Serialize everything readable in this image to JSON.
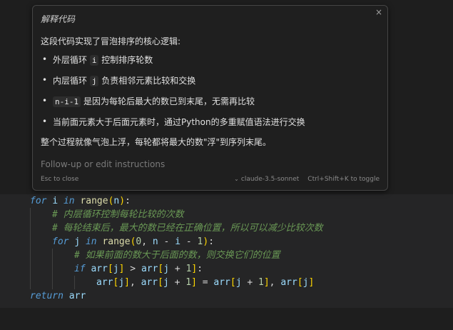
{
  "widget": {
    "title": "解释代码",
    "intro": "这段代码实现了冒泡排序的核心逻辑:",
    "bullet": "•",
    "items": [
      {
        "pre": "外层循环 ",
        "code": "i",
        "post": " 控制排序轮数"
      },
      {
        "pre": "内层循环 ",
        "code": "j",
        "post": " 负责相邻元素比较和交换"
      },
      {
        "pre": "",
        "code": "n-i-1",
        "post": " 是因为每轮后最大的数已到末尾，无需再比较"
      },
      {
        "pre": "当前面元素大于后面元素时，通过Python的多重赋值语法进行交换",
        "code": "",
        "post": ""
      }
    ],
    "summary": "整个过程就像气泡上浮，每轮都将最大的数\"浮\"到序列末尾。",
    "input_placeholder": "Follow-up or edit instructions",
    "input_value": "",
    "esc_hint": "Esc to close",
    "model": "claude-3.5-sonnet",
    "toggle_hint": "Ctrl+Shift+K to toggle",
    "close_glyph": "×",
    "chevron_glyph": "⌄"
  },
  "code": {
    "l1": {
      "for": "for",
      "i": "i",
      "in": "in",
      "range": "range",
      "p1": "(",
      "n": "n",
      "p2": ")",
      "colon": ":"
    },
    "l2": "# 内层循环控制每轮比较的次数",
    "l3": "# 每轮结束后，最大的数已经在正确位置，所以可以减少比较次数",
    "l4": {
      "for": "for",
      "j": "j",
      "in": "in",
      "range": "range",
      "p1": "(",
      "zero": "0",
      "comma": ", ",
      "n": "n",
      "minus1": " - ",
      "i": "i",
      "minus2": " - ",
      "one": "1",
      "p2": ")",
      "colon": ":"
    },
    "l5": "# 如果前面的数大于后面的数，则交换它们的位置",
    "l6": {
      "if": "if",
      "arr1": "arr",
      "b1": "[",
      "j1": "j",
      "b2": "]",
      "gt": " > ",
      "arr2": "arr",
      "b3": "[",
      "j2": "j",
      "plus": " + ",
      "one": "1",
      "b4": "]",
      "colon": ":"
    },
    "l7": {
      "arr1": "arr",
      "b1": "[",
      "j1": "j",
      "b2": "]",
      "comma1": ", ",
      "arr2": "arr",
      "b3": "[",
      "j2": "j",
      "plus1": " + ",
      "one1": "1",
      "b4": "]",
      "eq": " = ",
      "arr3": "arr",
      "b5": "[",
      "j3": "j",
      "plus2": " + ",
      "one2": "1",
      "b6": "]",
      "comma2": ", ",
      "arr4": "arr",
      "b7": "[",
      "j4": "j",
      "b8": "]"
    },
    "l8": {
      "return": "return",
      "arr": "arr"
    }
  },
  "colors": {
    "editor_bg": "#1e1e1e",
    "keyword": "#569cd6",
    "function": "#dcdcaa",
    "number": "#b5cea8",
    "variable": "#9cdcfe",
    "comment": "#6a9955",
    "bracket_1": "#ffd700",
    "bracket_2": "#da70d6",
    "bracket_3": "#179fff"
  }
}
